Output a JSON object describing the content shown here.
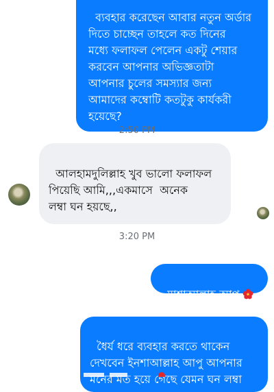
{
  "messages": [
    {
      "id": "m1",
      "direction": "outgoing",
      "text": "ব্যবহার করেছেন আবার নতুন অর্ডার\nদিতে চাচ্ছেন তাহলে কত দিনের\nমধ্যে ফলাফল পেলেন একটু শেয়ার\nকরবেন আপনার অভিজ্ঞতাটা\nআপনার চুলের সমস্যার জন্য\nআমাদের কম্বোটি কতটুকু কার্যকরী\nহয়েছে?"
    },
    {
      "id": "t1",
      "type": "timestamp",
      "text": "2:50 PM"
    },
    {
      "id": "m2",
      "direction": "incoming",
      "text": "আলহামদুলিল্লাহ খুব ভালো ফলাফল\nপিয়েছি আমি,,,একমাসে  অনেক\nলম্বা ঘন হয়ছে,,"
    },
    {
      "id": "t2",
      "type": "timestamp",
      "text": "3:20 PM"
    },
    {
      "id": "m3",
      "direction": "outgoing",
      "text": "মাশাআল্লাহ আপু"
    },
    {
      "id": "m4",
      "direction": "outgoing",
      "text": "ধৈর্য ধরে ব্যবহার করতে থাকেন\nদেখবেন ইনশাআল্লাহ আপু আপনার\nমনের মত হয়ে গেছে যেমন ঘন লম্বা"
    }
  ],
  "colors": {
    "outgoing_bubble": "#0a7cff",
    "incoming_bubble": "#eef0f3",
    "timestamp_text": "#6b6f76",
    "flower_emoji": "#e0282e"
  },
  "icons": {
    "flower": "hibiscus-emoji",
    "avatar": "contact-avatar",
    "read_receipt": "seen-avatar"
  }
}
